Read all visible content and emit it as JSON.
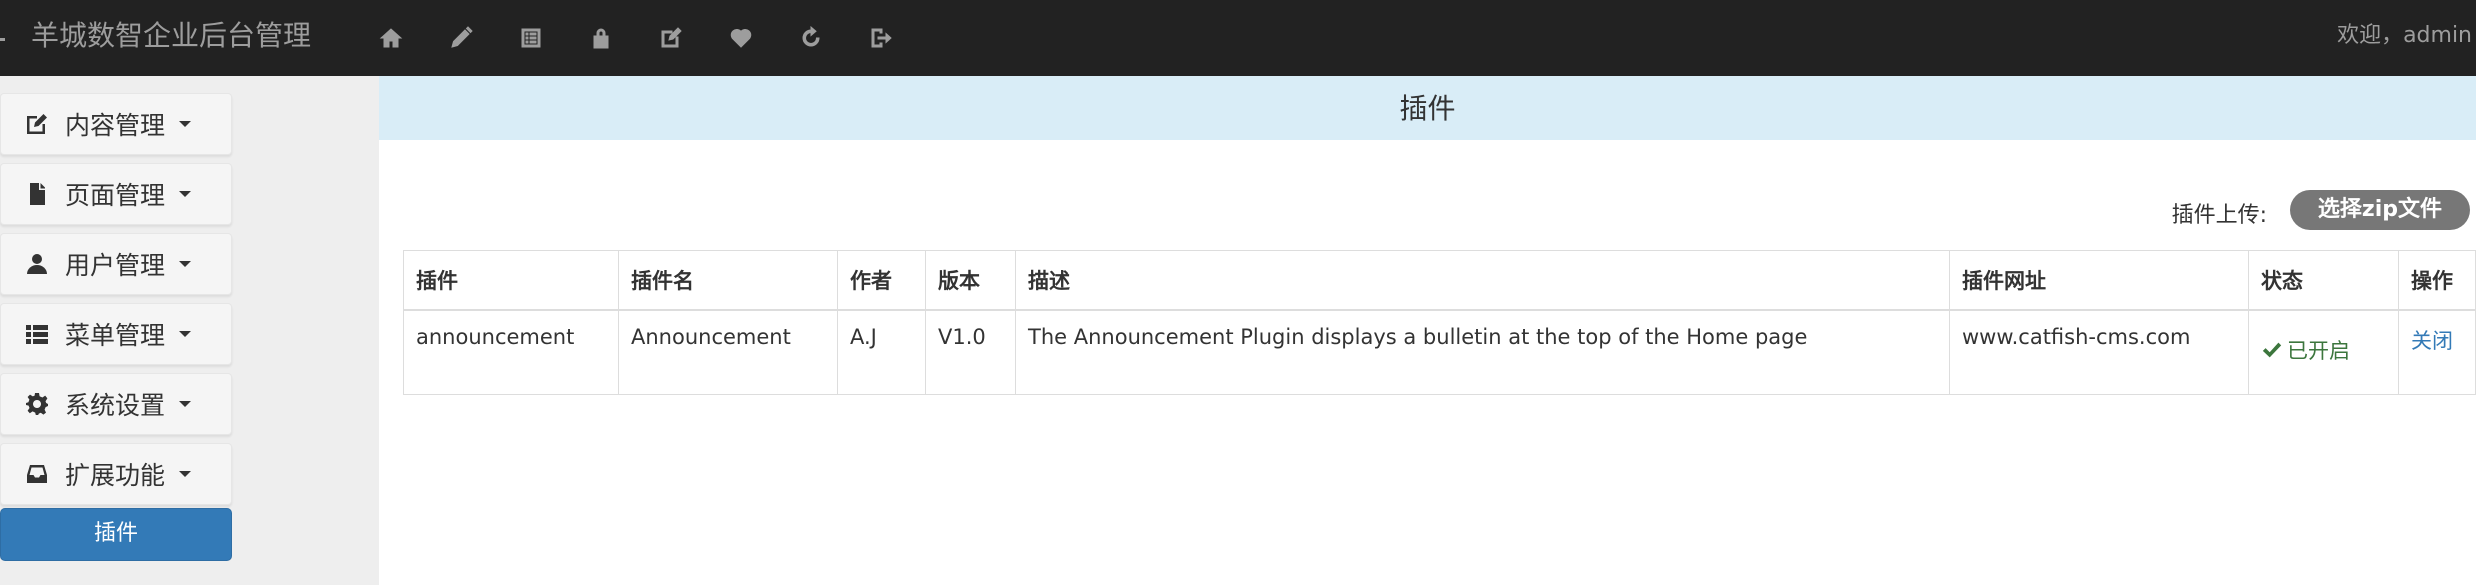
{
  "navbar": {
    "brand": "羊城数智企业后台管理",
    "icons": [
      "home-icon",
      "pencil-icon",
      "list-alt-icon",
      "lock-icon",
      "edit-icon",
      "heart-icon",
      "refresh-icon",
      "log-out-icon"
    ],
    "welcome": "欢迎，admin"
  },
  "sidebar": {
    "menus": [
      {
        "label": "内容管理",
        "icon": "edit-icon"
      },
      {
        "label": "页面管理",
        "icon": "file-icon"
      },
      {
        "label": "用户管理",
        "icon": "user-icon"
      },
      {
        "label": "菜单管理",
        "icon": "th-list-icon"
      },
      {
        "label": "系统设置",
        "icon": "cog-icon"
      },
      {
        "label": "扩展功能",
        "icon": "inbox-icon"
      }
    ],
    "active_submenu": "插件"
  },
  "main": {
    "title": "插件",
    "upload_label": "插件上传:",
    "upload_button": "选择zip文件",
    "table": {
      "headers": [
        "插件",
        "插件名",
        "作者",
        "版本",
        "描述",
        "插件网址",
        "状态",
        "操作"
      ],
      "rows": [
        {
          "plugin": "announcement",
          "name": "Announcement",
          "author": "A.J",
          "version": "V1.0",
          "description": "The Announcement Plugin displays a bulletin at the top of the Home page",
          "url": "www.catfish-cms.com",
          "status": "已开启",
          "action": "关闭"
        }
      ]
    }
  },
  "colors": {
    "navbar_bg": "#222222",
    "sidebar_bg": "#eeeeee",
    "header_bg": "#d9edf7",
    "primary": "#337ab7",
    "success": "#3c763d",
    "upload_btn": "#777777"
  }
}
